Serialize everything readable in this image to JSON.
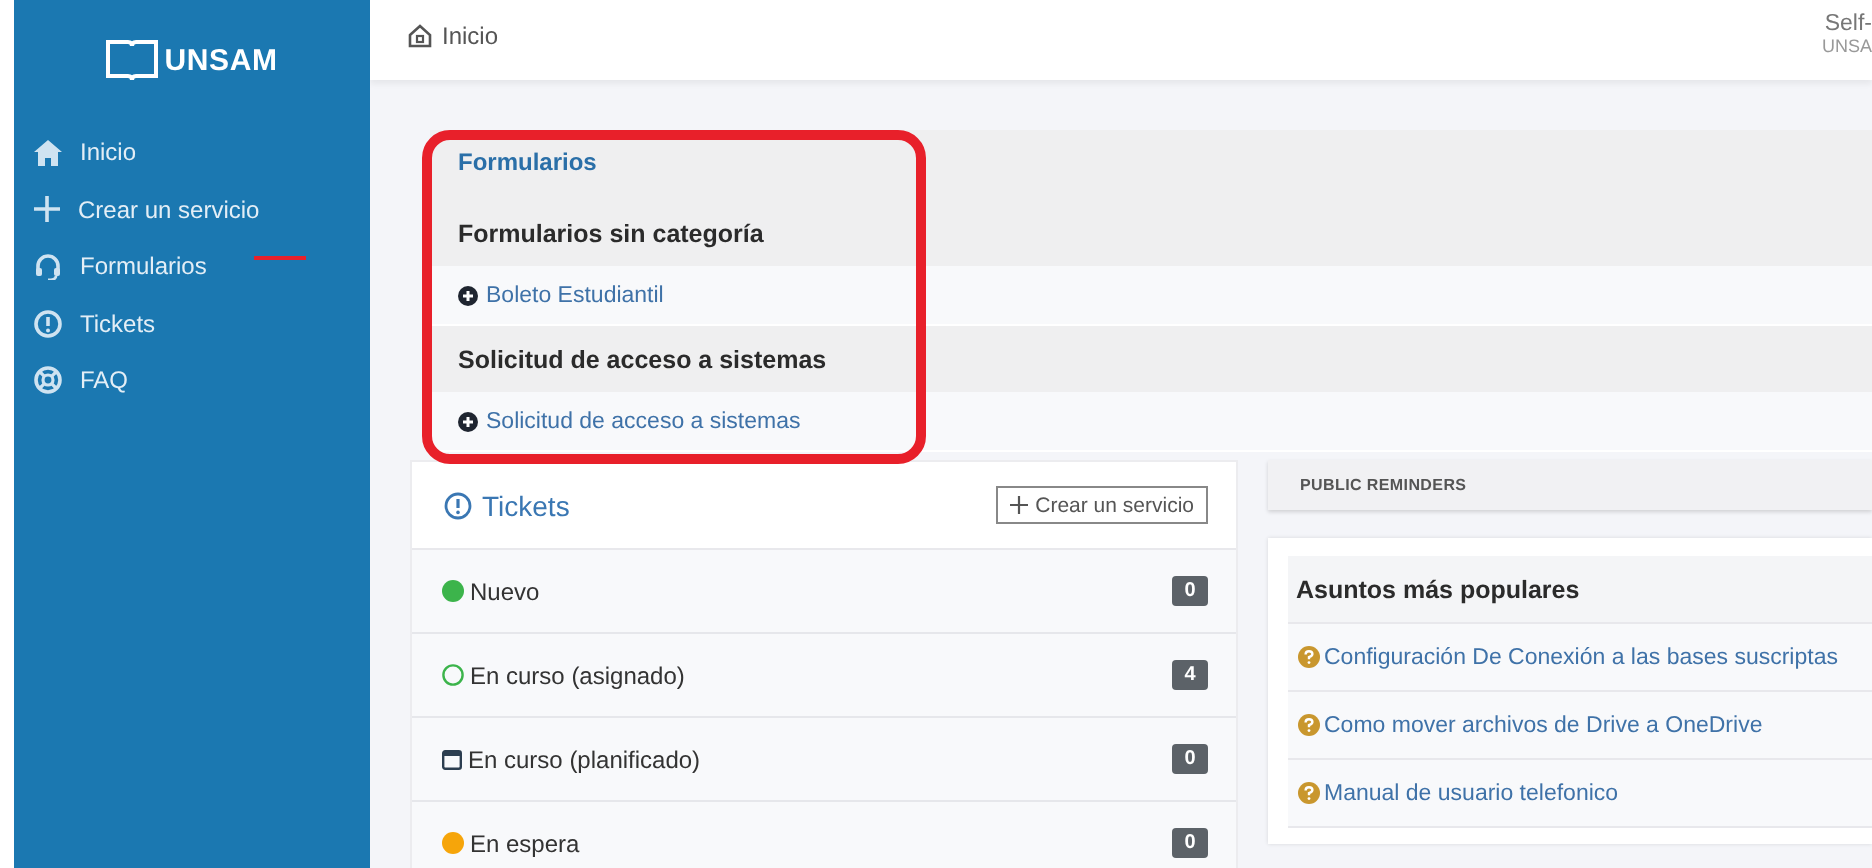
{
  "sidebar": {
    "logo": "UNSAM",
    "items": [
      {
        "label": "Inicio",
        "kind": "home"
      },
      {
        "label": "Crear un servicio",
        "kind": "plus"
      },
      {
        "label": "Formularios",
        "kind": "headset"
      },
      {
        "label": "Tickets",
        "kind": "alert"
      },
      {
        "label": "FAQ",
        "kind": "lifebuoy"
      }
    ]
  },
  "header": {
    "breadcrumb": "Inicio",
    "user_line_1": "Self-",
    "user_line_2": "UNSA"
  },
  "forms": {
    "title": "Formularios",
    "categories": [
      {
        "name": "Formularios sin categoría",
        "items": [
          "Boleto Estudiantil"
        ]
      },
      {
        "name": "Solicitud de acceso a sistemas",
        "items": [
          "Solicitud de acceso a sistemas"
        ]
      }
    ]
  },
  "tickets": {
    "title": "Tickets",
    "button": "Crear un servicio",
    "rows": [
      {
        "label": "Nuevo",
        "kind": "dot",
        "color": "#3cb44b",
        "count": "0"
      },
      {
        "label": "En curso (asignado)",
        "kind": "ring",
        "color": "#3cb44b",
        "count": "4"
      },
      {
        "label": "En curso (planificado)",
        "kind": "calendar",
        "color": "#2c3e50",
        "count": "0"
      },
      {
        "label": "En espera",
        "kind": "dot",
        "color": "#f6a50a",
        "count": "0"
      }
    ]
  },
  "reminders": {
    "title": "PUBLIC REMINDERS"
  },
  "popular": {
    "title": "Asuntos más populares",
    "items": [
      "Configuración De Conexión a las bases suscriptas",
      "Como mover archivos de Drive a OneDrive",
      "Manual de usuario telefonico"
    ]
  },
  "annotations": {
    "highlight_frame": true,
    "highlight_underline": true
  }
}
